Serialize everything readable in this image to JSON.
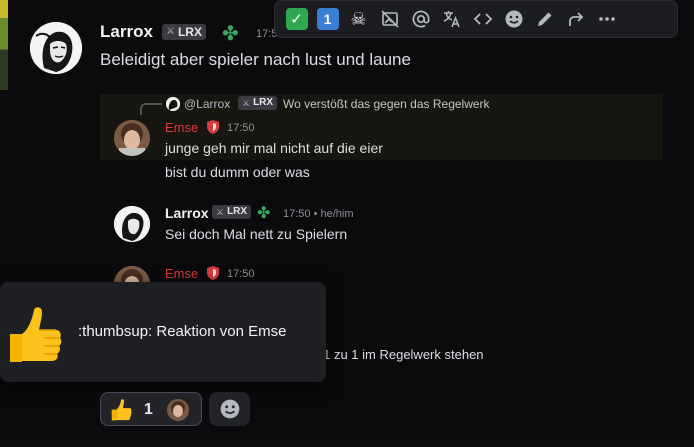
{
  "colors": {
    "background": "#0b0b0d",
    "emse_name": "#e03a3a",
    "clover": "#3ba55d",
    "reply_bg": "#17150f"
  },
  "toolbar": {
    "items": [
      {
        "name": "check-mark-emoji-reaction",
        "icon": "check-button-emoji"
      },
      {
        "name": "keycap-one-emoji-reaction",
        "icon": "keycap-1-emoji"
      },
      {
        "name": "skull-emoji-reaction",
        "icon": "skull-emoji"
      },
      {
        "name": "hide-embeds",
        "icon": "image-off-icon"
      },
      {
        "name": "mention",
        "icon": "at-sign-icon"
      },
      {
        "name": "translate",
        "icon": "translate-icon"
      },
      {
        "name": "code",
        "icon": "code-icon"
      },
      {
        "name": "add-reaction",
        "icon": "smiley-icon"
      },
      {
        "name": "edit",
        "icon": "pencil-icon"
      },
      {
        "name": "forward",
        "icon": "forward-icon"
      },
      {
        "name": "more",
        "icon": "more-dots-icon"
      }
    ]
  },
  "message1": {
    "author": "Larrox",
    "tag": "LRX",
    "timestamp": "17:5",
    "text": "Beleidigt aber spieler nach lust und laune"
  },
  "reply": {
    "ref_author": "@Larrox",
    "ref_tag": "LRX",
    "ref_text": "Wo verstößt das gegen das Regelwerk",
    "author": "Emse",
    "timestamp": "17:50",
    "lines": [
      "junge geh mir mal nicht auf die eier",
      "bist du dumm oder was"
    ]
  },
  "message2": {
    "author": "Larrox",
    "tag": "LRX",
    "timestamp": "17:50 • he/him",
    "text": "Sei doch Mal nett zu Spielern"
  },
  "message3": {
    "author": "Emse",
    "timestamp": "17:50",
    "partial_text": "s 1 zu 1 im Regelwerk stehen"
  },
  "tooltip": {
    "text": ":thumbsup: Reaktion von Emse",
    "icon": "thumbs-up-emoji"
  },
  "reaction": {
    "icon": "thumbs-up-emoji",
    "count": "1"
  },
  "add_reaction": {
    "icon": "smiley-icon"
  }
}
